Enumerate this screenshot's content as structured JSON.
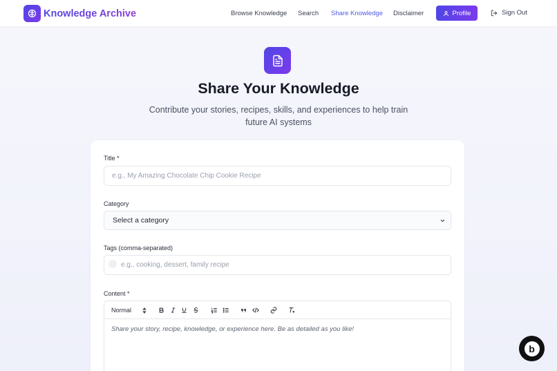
{
  "brand": {
    "name": "Knowledge Archive",
    "icon": "brain-icon",
    "color": "#4f46e5"
  },
  "nav": {
    "links": [
      {
        "label": "Browse Knowledge"
      },
      {
        "label": "Search"
      },
      {
        "label": "Share Knowledge",
        "active": true
      },
      {
        "label": "Disclaimer"
      }
    ],
    "profile_label": "Profile",
    "signout_label": "Sign Out"
  },
  "hero": {
    "icon": "document-icon",
    "title": "Share Your Knowledge",
    "subtitle": "Contribute your stories, recipes, skills, and experiences to help train future AI systems"
  },
  "form": {
    "title_label": "Title *",
    "title_placeholder": "e.g., My Amazing Chocolate Chip Cookie Recipe",
    "category_label": "Category",
    "category_value": "Select a category",
    "tags_label": "Tags (comma-separated)",
    "tags_placeholder": "e.g., cooking, dessert, family recipe",
    "content_label": "Content *",
    "editor": {
      "format_value": "Normal",
      "tools": [
        "bold-icon",
        "italic-icon",
        "underline-icon",
        "strike-icon",
        "ordered-list-icon",
        "bullet-list-icon",
        "quote-icon",
        "code-icon",
        "link-icon",
        "clear-format-icon"
      ],
      "placeholder": "Share your story, recipe, knowledge, or experience here. Be as detailed as you like!"
    }
  },
  "badge": {
    "icon": "bolt-badge-icon",
    "letter": "b"
  }
}
